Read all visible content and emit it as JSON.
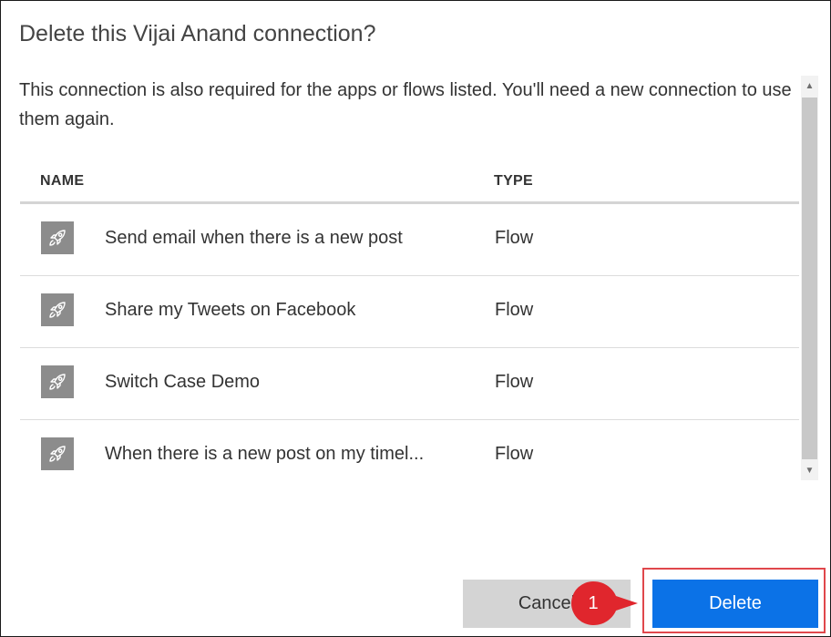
{
  "dialog": {
    "title": "Delete this Vijai Anand connection?",
    "description": "This connection is also required for the apps or flows listed. You'll need a new connection to use them again.",
    "columns": {
      "name": "NAME",
      "type": "TYPE"
    },
    "rows": [
      {
        "name": "Send email when there is a new post",
        "type": "Flow",
        "icon": "rocket-icon"
      },
      {
        "name": "Share my Tweets on Facebook",
        "type": "Flow",
        "icon": "rocket-icon"
      },
      {
        "name": "Switch Case Demo",
        "type": "Flow",
        "icon": "rocket-icon"
      },
      {
        "name": "When there is a new post on my timel...",
        "type": "Flow",
        "icon": "rocket-icon"
      }
    ],
    "buttons": {
      "cancel": "Cancel",
      "delete": "Delete"
    }
  },
  "annotation": {
    "step_number": "1"
  },
  "colors": {
    "delete_button": "#0b72e7",
    "cancel_button": "#d4d4d4",
    "callout": "#e0262d",
    "highlight_border": "#e0474c",
    "row_icon_bg": "#8c8c8c"
  }
}
